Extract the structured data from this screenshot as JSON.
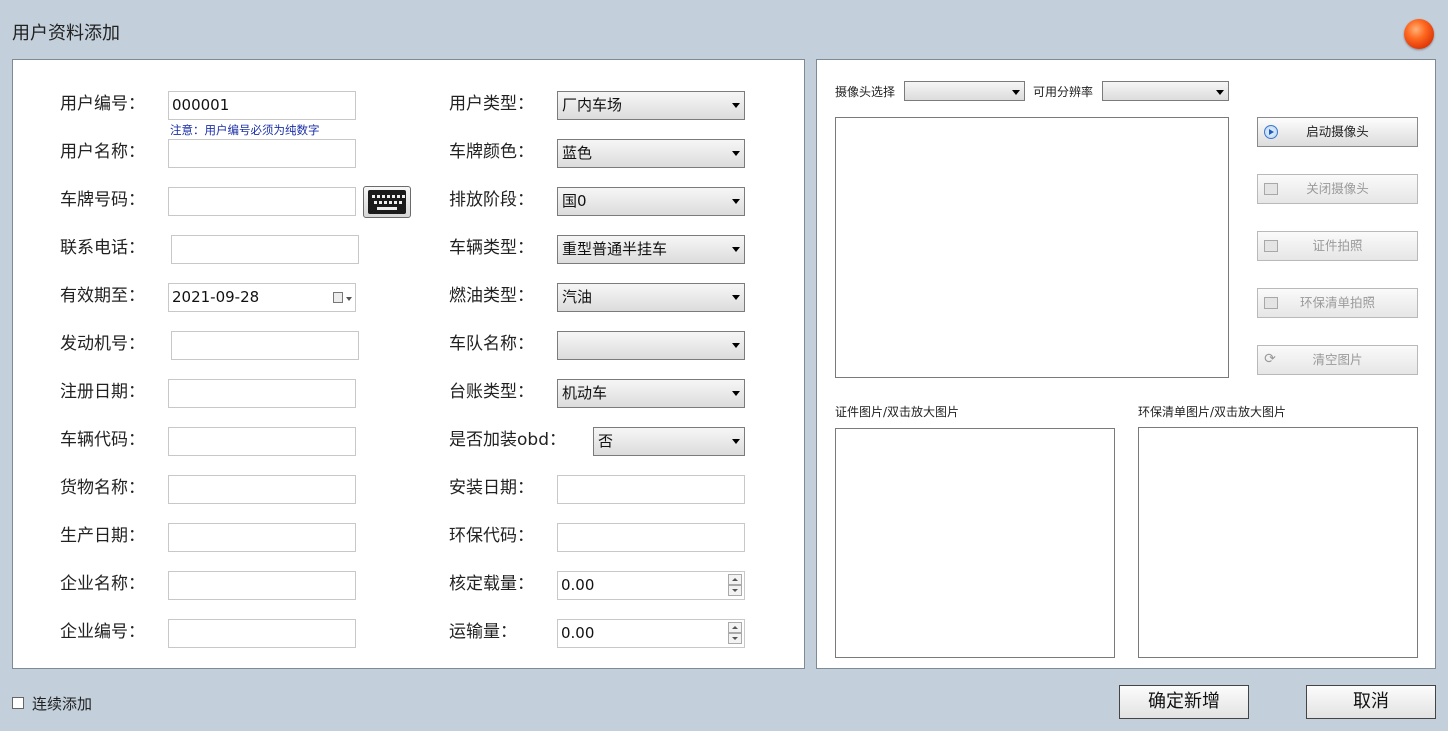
{
  "window": {
    "title": "用户资料添加",
    "close_icon": "close-orb-icon"
  },
  "form": {
    "left_labels": [
      "用户编号：",
      "用户名称：",
      "车牌号码：",
      "联系电话：",
      "有效期至：",
      "发动机号：",
      "注册日期：",
      "车辆代码：",
      "货物名称：",
      "生产日期：",
      "企业名称：",
      "企业编号："
    ],
    "user_id_value": "000001",
    "user_id_note": "注意：用户编号必须为纯数字",
    "expiry_date_value": "2021-09-28",
    "right_labels": [
      "用户类型：",
      "车牌颜色：",
      "排放阶段：",
      "车辆类型：",
      "燃油类型：",
      "车队名称：",
      "台账类型：",
      "是否加装obd：",
      "安装日期：",
      "环保代码：",
      "核定载量：",
      "运输量："
    ],
    "user_type": "厂内车场",
    "plate_color": "蓝色",
    "emission_stage": "国0",
    "vehicle_type": "重型普通半挂车",
    "fuel_type": "汽油",
    "fleet_name": "",
    "ledger_type": "机动车",
    "obd_installed": "否",
    "rated_load": "0.00",
    "transport_volume": "0.00"
  },
  "camera": {
    "camera_select_label": "摄像头选择",
    "resolution_label": "可用分辨率",
    "camera_value": "",
    "resolution_value": "",
    "buttons": {
      "start": "启动摄像头",
      "stop": "关闭摄像头",
      "id_photo": "证件拍照",
      "env_photo": "环保清单拍照",
      "clear": "清空图片"
    },
    "id_image_label": "证件图片/双击放大图片",
    "env_image_label": "环保清单图片/双击放大图片"
  },
  "footer": {
    "continuous_add_label": "连续添加",
    "confirm_label": "确定新增",
    "cancel_label": "取消"
  }
}
